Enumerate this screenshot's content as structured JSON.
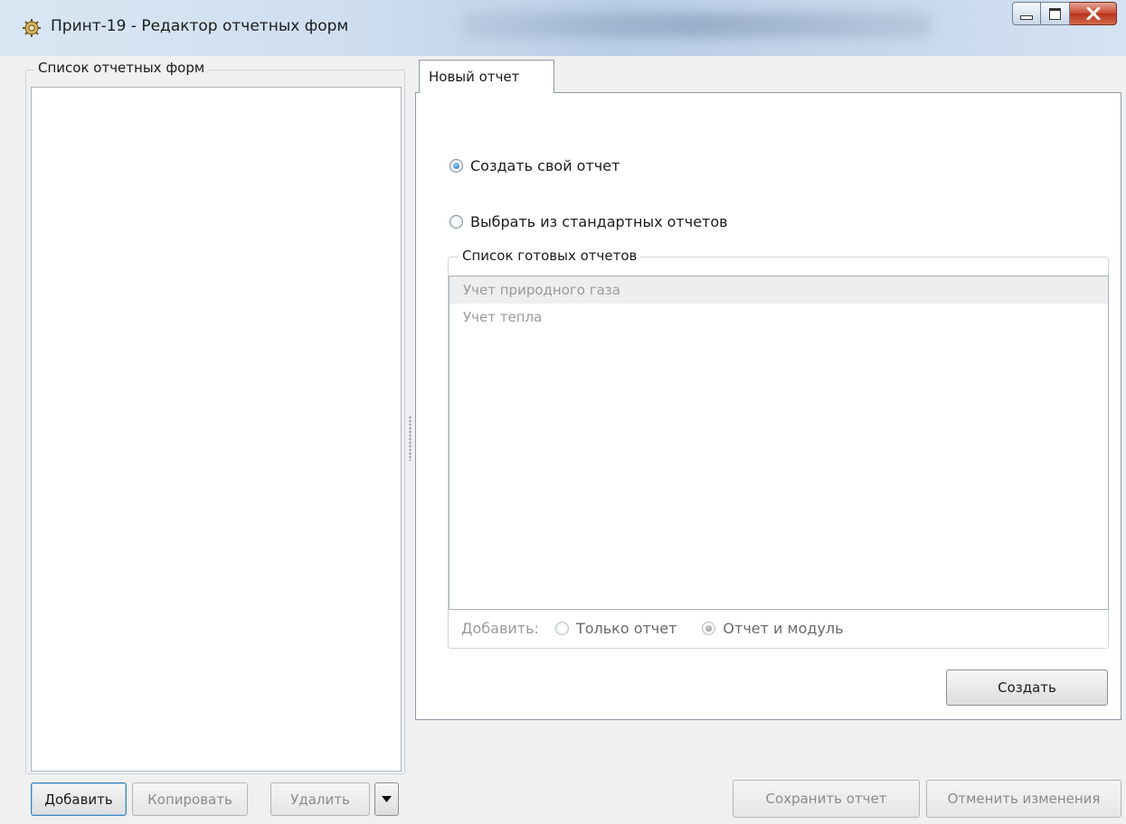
{
  "window": {
    "title": "Принт-19 - Редактор отчетных форм",
    "controls": [
      "minimize-icon",
      "maximize-icon",
      "close-icon"
    ]
  },
  "left_panel": {
    "group_label": "Список отчетных форм",
    "buttons": {
      "add": "Добавить",
      "copy": "Копировать",
      "delete": "Удалить"
    }
  },
  "tabs": [
    {
      "label": "Новый отчет",
      "active": true
    }
  ],
  "new_report": {
    "option_custom": "Создать свой отчет",
    "option_standard": "Выбрать из стандартных отчетов",
    "selected_option": "custom",
    "std_group_label": "Список готовых отчетов",
    "std_reports": [
      "Учет природного газа",
      "Учет тепла"
    ],
    "add_label": "Добавить:",
    "add_options": [
      "Только отчет",
      "Отчет и модуль"
    ],
    "add_selected": "Отчет и модуль",
    "create_button": "Создать"
  },
  "footer": {
    "save_button": "Сохранить отчет",
    "cancel_button": "Отменить изменения"
  },
  "colors": {
    "accent": "#1f6fb5",
    "title_bar": "#cfdff0",
    "close_button": "#c8482f",
    "disabled_text": "#9a9a9a"
  }
}
